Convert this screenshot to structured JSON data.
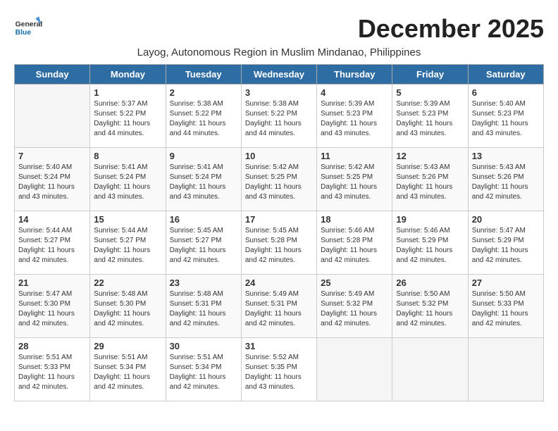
{
  "header": {
    "logo_general": "General",
    "logo_blue": "Blue",
    "month_title": "December 2025",
    "subtitle": "Layog, Autonomous Region in Muslim Mindanao, Philippines"
  },
  "days_of_week": [
    "Sunday",
    "Monday",
    "Tuesday",
    "Wednesday",
    "Thursday",
    "Friday",
    "Saturday"
  ],
  "weeks": [
    [
      {
        "day": "",
        "info": ""
      },
      {
        "day": "1",
        "info": "Sunrise: 5:37 AM\nSunset: 5:22 PM\nDaylight: 11 hours\nand 44 minutes."
      },
      {
        "day": "2",
        "info": "Sunrise: 5:38 AM\nSunset: 5:22 PM\nDaylight: 11 hours\nand 44 minutes."
      },
      {
        "day": "3",
        "info": "Sunrise: 5:38 AM\nSunset: 5:22 PM\nDaylight: 11 hours\nand 44 minutes."
      },
      {
        "day": "4",
        "info": "Sunrise: 5:39 AM\nSunset: 5:23 PM\nDaylight: 11 hours\nand 43 minutes."
      },
      {
        "day": "5",
        "info": "Sunrise: 5:39 AM\nSunset: 5:23 PM\nDaylight: 11 hours\nand 43 minutes."
      },
      {
        "day": "6",
        "info": "Sunrise: 5:40 AM\nSunset: 5:23 PM\nDaylight: 11 hours\nand 43 minutes."
      }
    ],
    [
      {
        "day": "7",
        "info": "Sunrise: 5:40 AM\nSunset: 5:24 PM\nDaylight: 11 hours\nand 43 minutes."
      },
      {
        "day": "8",
        "info": "Sunrise: 5:41 AM\nSunset: 5:24 PM\nDaylight: 11 hours\nand 43 minutes."
      },
      {
        "day": "9",
        "info": "Sunrise: 5:41 AM\nSunset: 5:24 PM\nDaylight: 11 hours\nand 43 minutes."
      },
      {
        "day": "10",
        "info": "Sunrise: 5:42 AM\nSunset: 5:25 PM\nDaylight: 11 hours\nand 43 minutes."
      },
      {
        "day": "11",
        "info": "Sunrise: 5:42 AM\nSunset: 5:25 PM\nDaylight: 11 hours\nand 43 minutes."
      },
      {
        "day": "12",
        "info": "Sunrise: 5:43 AM\nSunset: 5:26 PM\nDaylight: 11 hours\nand 43 minutes."
      },
      {
        "day": "13",
        "info": "Sunrise: 5:43 AM\nSunset: 5:26 PM\nDaylight: 11 hours\nand 42 minutes."
      }
    ],
    [
      {
        "day": "14",
        "info": "Sunrise: 5:44 AM\nSunset: 5:27 PM\nDaylight: 11 hours\nand 42 minutes."
      },
      {
        "day": "15",
        "info": "Sunrise: 5:44 AM\nSunset: 5:27 PM\nDaylight: 11 hours\nand 42 minutes."
      },
      {
        "day": "16",
        "info": "Sunrise: 5:45 AM\nSunset: 5:27 PM\nDaylight: 11 hours\nand 42 minutes."
      },
      {
        "day": "17",
        "info": "Sunrise: 5:45 AM\nSunset: 5:28 PM\nDaylight: 11 hours\nand 42 minutes."
      },
      {
        "day": "18",
        "info": "Sunrise: 5:46 AM\nSunset: 5:28 PM\nDaylight: 11 hours\nand 42 minutes."
      },
      {
        "day": "19",
        "info": "Sunrise: 5:46 AM\nSunset: 5:29 PM\nDaylight: 11 hours\nand 42 minutes."
      },
      {
        "day": "20",
        "info": "Sunrise: 5:47 AM\nSunset: 5:29 PM\nDaylight: 11 hours\nand 42 minutes."
      }
    ],
    [
      {
        "day": "21",
        "info": "Sunrise: 5:47 AM\nSunset: 5:30 PM\nDaylight: 11 hours\nand 42 minutes."
      },
      {
        "day": "22",
        "info": "Sunrise: 5:48 AM\nSunset: 5:30 PM\nDaylight: 11 hours\nand 42 minutes."
      },
      {
        "day": "23",
        "info": "Sunrise: 5:48 AM\nSunset: 5:31 PM\nDaylight: 11 hours\nand 42 minutes."
      },
      {
        "day": "24",
        "info": "Sunrise: 5:49 AM\nSunset: 5:31 PM\nDaylight: 11 hours\nand 42 minutes."
      },
      {
        "day": "25",
        "info": "Sunrise: 5:49 AM\nSunset: 5:32 PM\nDaylight: 11 hours\nand 42 minutes."
      },
      {
        "day": "26",
        "info": "Sunrise: 5:50 AM\nSunset: 5:32 PM\nDaylight: 11 hours\nand 42 minutes."
      },
      {
        "day": "27",
        "info": "Sunrise: 5:50 AM\nSunset: 5:33 PM\nDaylight: 11 hours\nand 42 minutes."
      }
    ],
    [
      {
        "day": "28",
        "info": "Sunrise: 5:51 AM\nSunset: 5:33 PM\nDaylight: 11 hours\nand 42 minutes."
      },
      {
        "day": "29",
        "info": "Sunrise: 5:51 AM\nSunset: 5:34 PM\nDaylight: 11 hours\nand 42 minutes."
      },
      {
        "day": "30",
        "info": "Sunrise: 5:51 AM\nSunset: 5:34 PM\nDaylight: 11 hours\nand 42 minutes."
      },
      {
        "day": "31",
        "info": "Sunrise: 5:52 AM\nSunset: 5:35 PM\nDaylight: 11 hours\nand 43 minutes."
      },
      {
        "day": "",
        "info": ""
      },
      {
        "day": "",
        "info": ""
      },
      {
        "day": "",
        "info": ""
      }
    ]
  ]
}
